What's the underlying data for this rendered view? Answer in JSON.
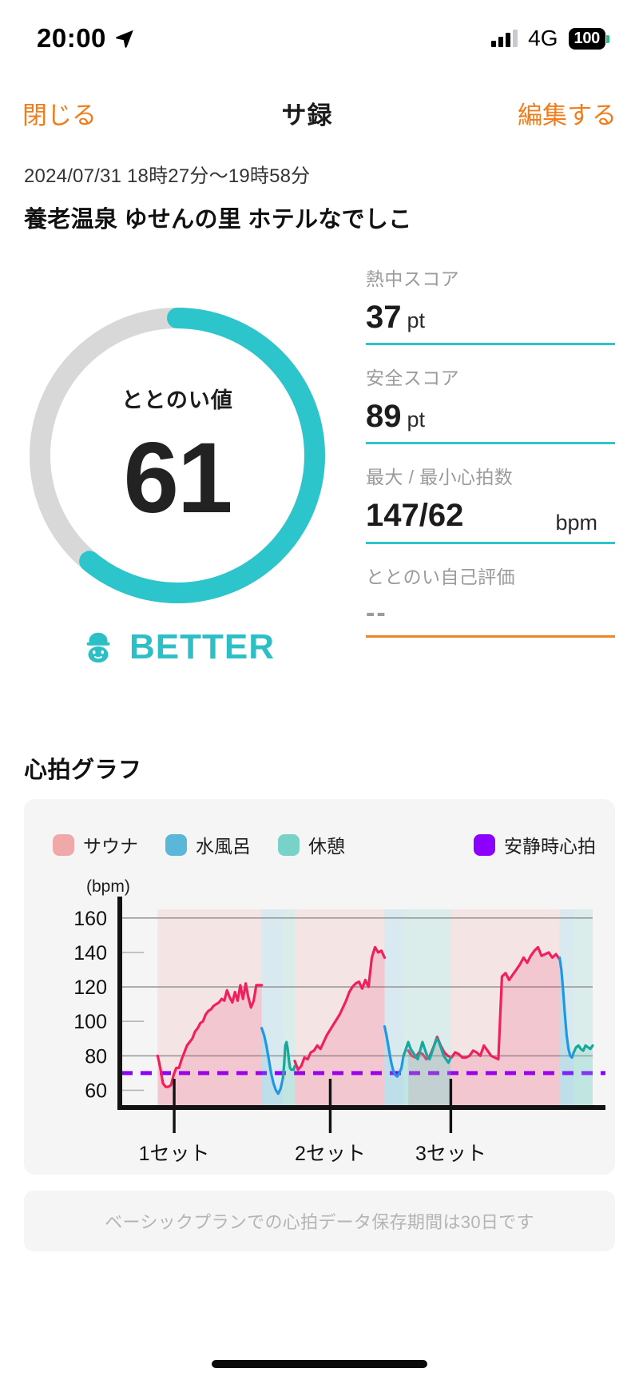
{
  "status_bar": {
    "time": "20:00",
    "location_icon": "location-arrow-icon",
    "network": "4G",
    "battery": "100"
  },
  "nav": {
    "close_label": "閉じる",
    "title": "サ録",
    "edit_label": "編集する"
  },
  "header": {
    "date_range": "2024/07/31 18時27分〜19時58分",
    "venue": "養老温泉 ゆせんの里 ホテルなでしこ"
  },
  "gauge": {
    "label": "ととのい値",
    "value": "61",
    "percent": 61,
    "track_color": "#d8d8d8",
    "progress_color": "#2cc5cc",
    "rating_text": "BETTER",
    "rating_color": "#2cbfc6",
    "rating_icon": "sauna-hat-face-icon"
  },
  "stats": [
    {
      "label": "熱中スコア",
      "value": "37",
      "unit": "pt",
      "underline": "#2cc5cc"
    },
    {
      "label": "安全スコア",
      "value": "89",
      "unit": "pt",
      "underline": "#2cc5cc"
    },
    {
      "label": "最大 / 最小心拍数",
      "value": "147/62",
      "unit": "bpm",
      "underline": "#2cc5cc"
    },
    {
      "label": "ととのい自己評価",
      "value": "--",
      "unit": "",
      "underline": "#ee8423"
    }
  ],
  "chart_section": {
    "title": "心拍グラフ",
    "footer_note": "ベーシックプランでの心拍データ保存期間は30日です"
  },
  "chart_data": {
    "type": "line",
    "title": "心拍グラフ",
    "ylabel": "(bpm)",
    "xlabel": "",
    "ylim": [
      50,
      165
    ],
    "yticks": [
      160,
      140,
      120,
      100,
      80,
      60
    ],
    "gridlines": [
      160,
      120,
      80
    ],
    "grid": true,
    "legend_position": "top",
    "legend": [
      {
        "name": "サウナ",
        "color": "#f0a9a9"
      },
      {
        "name": "水風呂",
        "color": "#5ab7d8"
      },
      {
        "name": "休憩",
        "color": "#79d2c8"
      },
      {
        "name": "安静時心拍",
        "color": "#8b00ff"
      }
    ],
    "xticks": [
      {
        "label": "1セット",
        "x": 0.115
      },
      {
        "label": "2セット",
        "x": 0.445
      },
      {
        "label": "3セット",
        "x": 0.7
      }
    ],
    "resting_hr": 70,
    "series": [
      {
        "name": "サウナ",
        "line_color": "#f01f5e",
        "fill_color": "rgba(240,31,94,0.14)",
        "segments": [
          {
            "from": 0.08,
            "to": 0.3,
            "values": [
              80,
              73,
              64,
              62,
              62,
              63,
              69,
              73,
              73,
              78,
              82,
              86,
              88,
              90,
              94,
              96,
              99,
              100,
              104,
              106,
              107,
              109,
              110,
              111,
              113,
              112,
              118,
              114,
              111,
              117,
              112,
              121,
              113,
              122,
              114,
              108,
              112,
              121,
              121,
              121
            ]
          },
          {
            "from": 0.37,
            "to": 0.56,
            "values": [
              77,
              72,
              74,
              79,
              78,
              82,
              83,
              86,
              84,
              88,
              92,
              95,
              98,
              101,
              104,
              108,
              112,
              117,
              120,
              122,
              123,
              119,
              124,
              120,
              137,
              143,
              140,
              141,
              137
            ]
          },
          {
            "from": 0.61,
            "to": 0.93,
            "values": [
              83,
              80,
              79,
              82,
              81,
              78,
              80,
              85,
              91,
              86,
              82,
              80,
              79,
              82,
              81,
              79,
              79,
              80,
              83,
              82,
              80,
              86,
              83,
              80,
              79,
              78,
              126,
              128,
              124,
              127,
              130,
              133,
              137,
              134,
              138,
              141,
              143,
              138,
              139,
              140,
              137,
              139,
              136
            ]
          }
        ]
      },
      {
        "name": "水風呂",
        "line_color": "#2196e3",
        "fill_color": "rgba(90,183,216,0.20)",
        "segments": [
          {
            "from": 0.3,
            "to": 0.345,
            "values": [
              96,
              92,
              86,
              78,
              70,
              64,
              60,
              58,
              61,
              67
            ]
          },
          {
            "from": 0.56,
            "to": 0.6,
            "values": [
              97,
              91,
              84,
              77,
              72,
              69,
              68,
              70,
              73,
              80
            ]
          },
          {
            "from": 0.93,
            "to": 0.96,
            "values": [
              137,
              130,
              118,
              104,
              92,
              84,
              80,
              79,
              82
            ]
          }
        ]
      },
      {
        "name": "休憩",
        "line_color": "#16a99b",
        "fill_color": "rgba(121,210,200,0.25)",
        "segments": [
          {
            "from": 0.345,
            "to": 0.37,
            "values": [
              67,
              75,
              86,
              88,
              84,
              78,
              73,
              72,
              72,
              72,
              74
            ]
          },
          {
            "from": 0.6,
            "to": 0.7,
            "values": [
              80,
              84,
              88,
              84,
              82,
              80,
              78,
              83,
              88,
              84,
              80,
              78,
              82,
              86,
              90,
              88,
              84,
              80,
              78,
              76,
              79
            ]
          },
          {
            "from": 0.96,
            "to": 1.0,
            "values": [
              82,
              85,
              86,
              84,
              83,
              86,
              85,
              84,
              86
            ]
          }
        ]
      }
    ],
    "bands": [
      {
        "type": "サウナ",
        "from": 0.08,
        "to": 0.3,
        "color": "rgba(240,169,169,0.22)"
      },
      {
        "type": "水風呂",
        "from": 0.3,
        "to": 0.345,
        "color": "rgba(90,183,216,0.18)"
      },
      {
        "type": "休憩",
        "from": 0.345,
        "to": 0.37,
        "color": "rgba(121,210,200,0.22)"
      },
      {
        "type": "サウナ",
        "from": 0.37,
        "to": 0.56,
        "color": "rgba(240,169,169,0.22)"
      },
      {
        "type": "水風呂",
        "from": 0.56,
        "to": 0.6,
        "color": "rgba(90,183,216,0.18)"
      },
      {
        "type": "休憩",
        "from": 0.6,
        "to": 0.7,
        "color": "rgba(121,210,200,0.22)"
      },
      {
        "type": "サウナ",
        "from": 0.7,
        "to": 0.93,
        "color": "rgba(240,169,169,0.22)"
      },
      {
        "type": "水風呂",
        "from": 0.93,
        "to": 0.96,
        "color": "rgba(90,183,216,0.18)"
      },
      {
        "type": "休憩",
        "from": 0.96,
        "to": 1.0,
        "color": "rgba(121,210,200,0.22)"
      }
    ]
  }
}
